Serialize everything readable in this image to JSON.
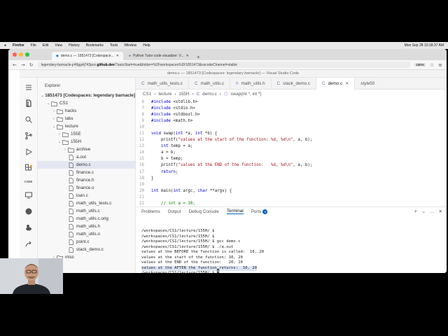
{
  "menubar": {
    "items": [
      "Firefox",
      "File",
      "Edit",
      "View",
      "History",
      "Bookmarks",
      "Tools",
      "Window",
      "Help"
    ],
    "clock": "Mon Sep 28  10:18:37 AM"
  },
  "browser": {
    "tabs": [
      {
        "label": "demo.c — 1851473 [Codespace..."
      },
      {
        "label": "Python Tutor code visualizer: V..."
      }
    ],
    "url_prefix": "legendary-barnacle-jr49gg4j743pvx.",
    "url_host": "github.dev",
    "url_suffix": "/?autoStart=true&folder=%2Fworkspaces%2F1851473&vscodeChannel=stable",
    "zoom": "180%"
  },
  "vscode": {
    "title": "demo.c — 1851473 [Codespaces: legendary barnacle] — Visual Studio Code",
    "explorer_title": "Explorer",
    "tree": [
      {
        "label": "1851473 [Codespaces: legendary barnacle]",
        "depth": 0,
        "chev": "⌄",
        "icon": "none"
      },
      {
        "label": "CS1",
        "depth": 1,
        "chev": "⌄",
        "icon": "folder"
      },
      {
        "label": "hacks",
        "depth": 2,
        "chev": "›",
        "icon": "folder"
      },
      {
        "label": "labs",
        "depth": 2,
        "chev": "›",
        "icon": "folder"
      },
      {
        "label": "lecture",
        "depth": 2,
        "chev": "⌄",
        "icon": "folder"
      },
      {
        "label": "155E",
        "depth": 3,
        "chev": "›",
        "icon": "folder"
      },
      {
        "label": "155H",
        "depth": 3,
        "chev": "⌄",
        "icon": "folder"
      },
      {
        "label": "archive",
        "depth": 4,
        "chev": "›",
        "icon": "folder"
      },
      {
        "label": "a.out",
        "depth": 4,
        "chev": "",
        "icon": "file"
      },
      {
        "label": "demo.c",
        "depth": 4,
        "chev": "",
        "icon": "file"
      },
      {
        "label": "finance.c",
        "depth": 4,
        "chev": "",
        "icon": "file"
      },
      {
        "label": "finance.h",
        "depth": 4,
        "chev": "",
        "icon": "file"
      },
      {
        "label": "finance.o",
        "depth": 4,
        "chev": "",
        "icon": "file"
      },
      {
        "label": "loan.c",
        "depth": 4,
        "chev": "",
        "icon": "file"
      },
      {
        "label": "math_utils_tests.c",
        "depth": 4,
        "chev": "",
        "icon": "file"
      },
      {
        "label": "math_utils.c",
        "depth": 4,
        "chev": "",
        "icon": "file"
      },
      {
        "label": "math_utils.c.orig",
        "depth": 4,
        "chev": "",
        "icon": "file"
      },
      {
        "label": "math_utils.h",
        "depth": 4,
        "chev": "",
        "icon": "file"
      },
      {
        "label": "math_utils.o",
        "depth": 4,
        "chev": "",
        "icon": "file"
      },
      {
        "label": "point.c",
        "depth": 4,
        "chev": "",
        "icon": "file"
      },
      {
        "label": "stack_demo.c",
        "depth": 4,
        "chev": "",
        "icon": "file"
      },
      {
        "label": "misc",
        "depth": 2,
        "chev": "›",
        "icon": "folder"
      }
    ],
    "editor_tabs": [
      {
        "label": "math_utils_tests.c"
      },
      {
        "label": "math_utils.c"
      },
      {
        "label": "math_utils.h"
      },
      {
        "label": "stack_demo.c"
      },
      {
        "label": "demo.c"
      },
      {
        "label": "style50"
      }
    ],
    "breadcrumb": [
      "CS1",
      "lecture",
      "155H",
      "demo.c",
      "swap(int *, int *)"
    ],
    "code_lines": [
      {
        "n": "6",
        "t": "#include <stdlib.h>"
      },
      {
        "n": "7",
        "t": "#include <stdio.h>"
      },
      {
        "n": "8",
        "t": "#include <stdbool.h>"
      },
      {
        "n": "9",
        "t": "#include <math.h>"
      },
      {
        "n": "10",
        "t": ""
      },
      {
        "n": "11",
        "t": "void swap(int *a, int *b) {"
      },
      {
        "n": "12",
        "t": "    printf(\"values at the start of the function: %d, %d\\n\", a, b);"
      },
      {
        "n": "13",
        "t": "    int temp = a;"
      },
      {
        "n": "14",
        "t": "    a = b;"
      },
      {
        "n": "15",
        "t": "    b = temp;"
      },
      {
        "n": "16",
        "t": "    printf(\"values at the END of the function:   %d, %d\\n\", a, b);"
      },
      {
        "n": "17",
        "t": "    return;"
      },
      {
        "n": "18",
        "t": "}"
      },
      {
        "n": "19",
        "t": ""
      },
      {
        "n": "20",
        "t": "int main(int argc, char **argv) {"
      },
      {
        "n": "21",
        "t": ""
      },
      {
        "n": "22",
        "t": "    // int a = 10;"
      }
    ],
    "panel_tabs": [
      {
        "label": "Problems"
      },
      {
        "label": "Output"
      },
      {
        "label": "Debug Console"
      },
      {
        "label": "Terminal"
      },
      {
        "label": "Ports"
      }
    ],
    "ports_badge": "4",
    "terminal_lines": [
      "/workspaces/CS1/lecture/155H/ $",
      "/workspaces/CS1/lecture/155H/ $",
      "/workspaces/CS1/lecture/155H/ $ gcc demo.c",
      "/workspaces/CS1/lecture/155H/ $ ./a.out",
      "values at the BEFORE the function is called:  10, 20",
      "values at the start of the function: 10, 20",
      "values at the END of the function:   20, 10",
      "values at the AFTER the function returns:  10, 20",
      "/workspaces/CS1/lecture/155H/ $ "
    ]
  }
}
